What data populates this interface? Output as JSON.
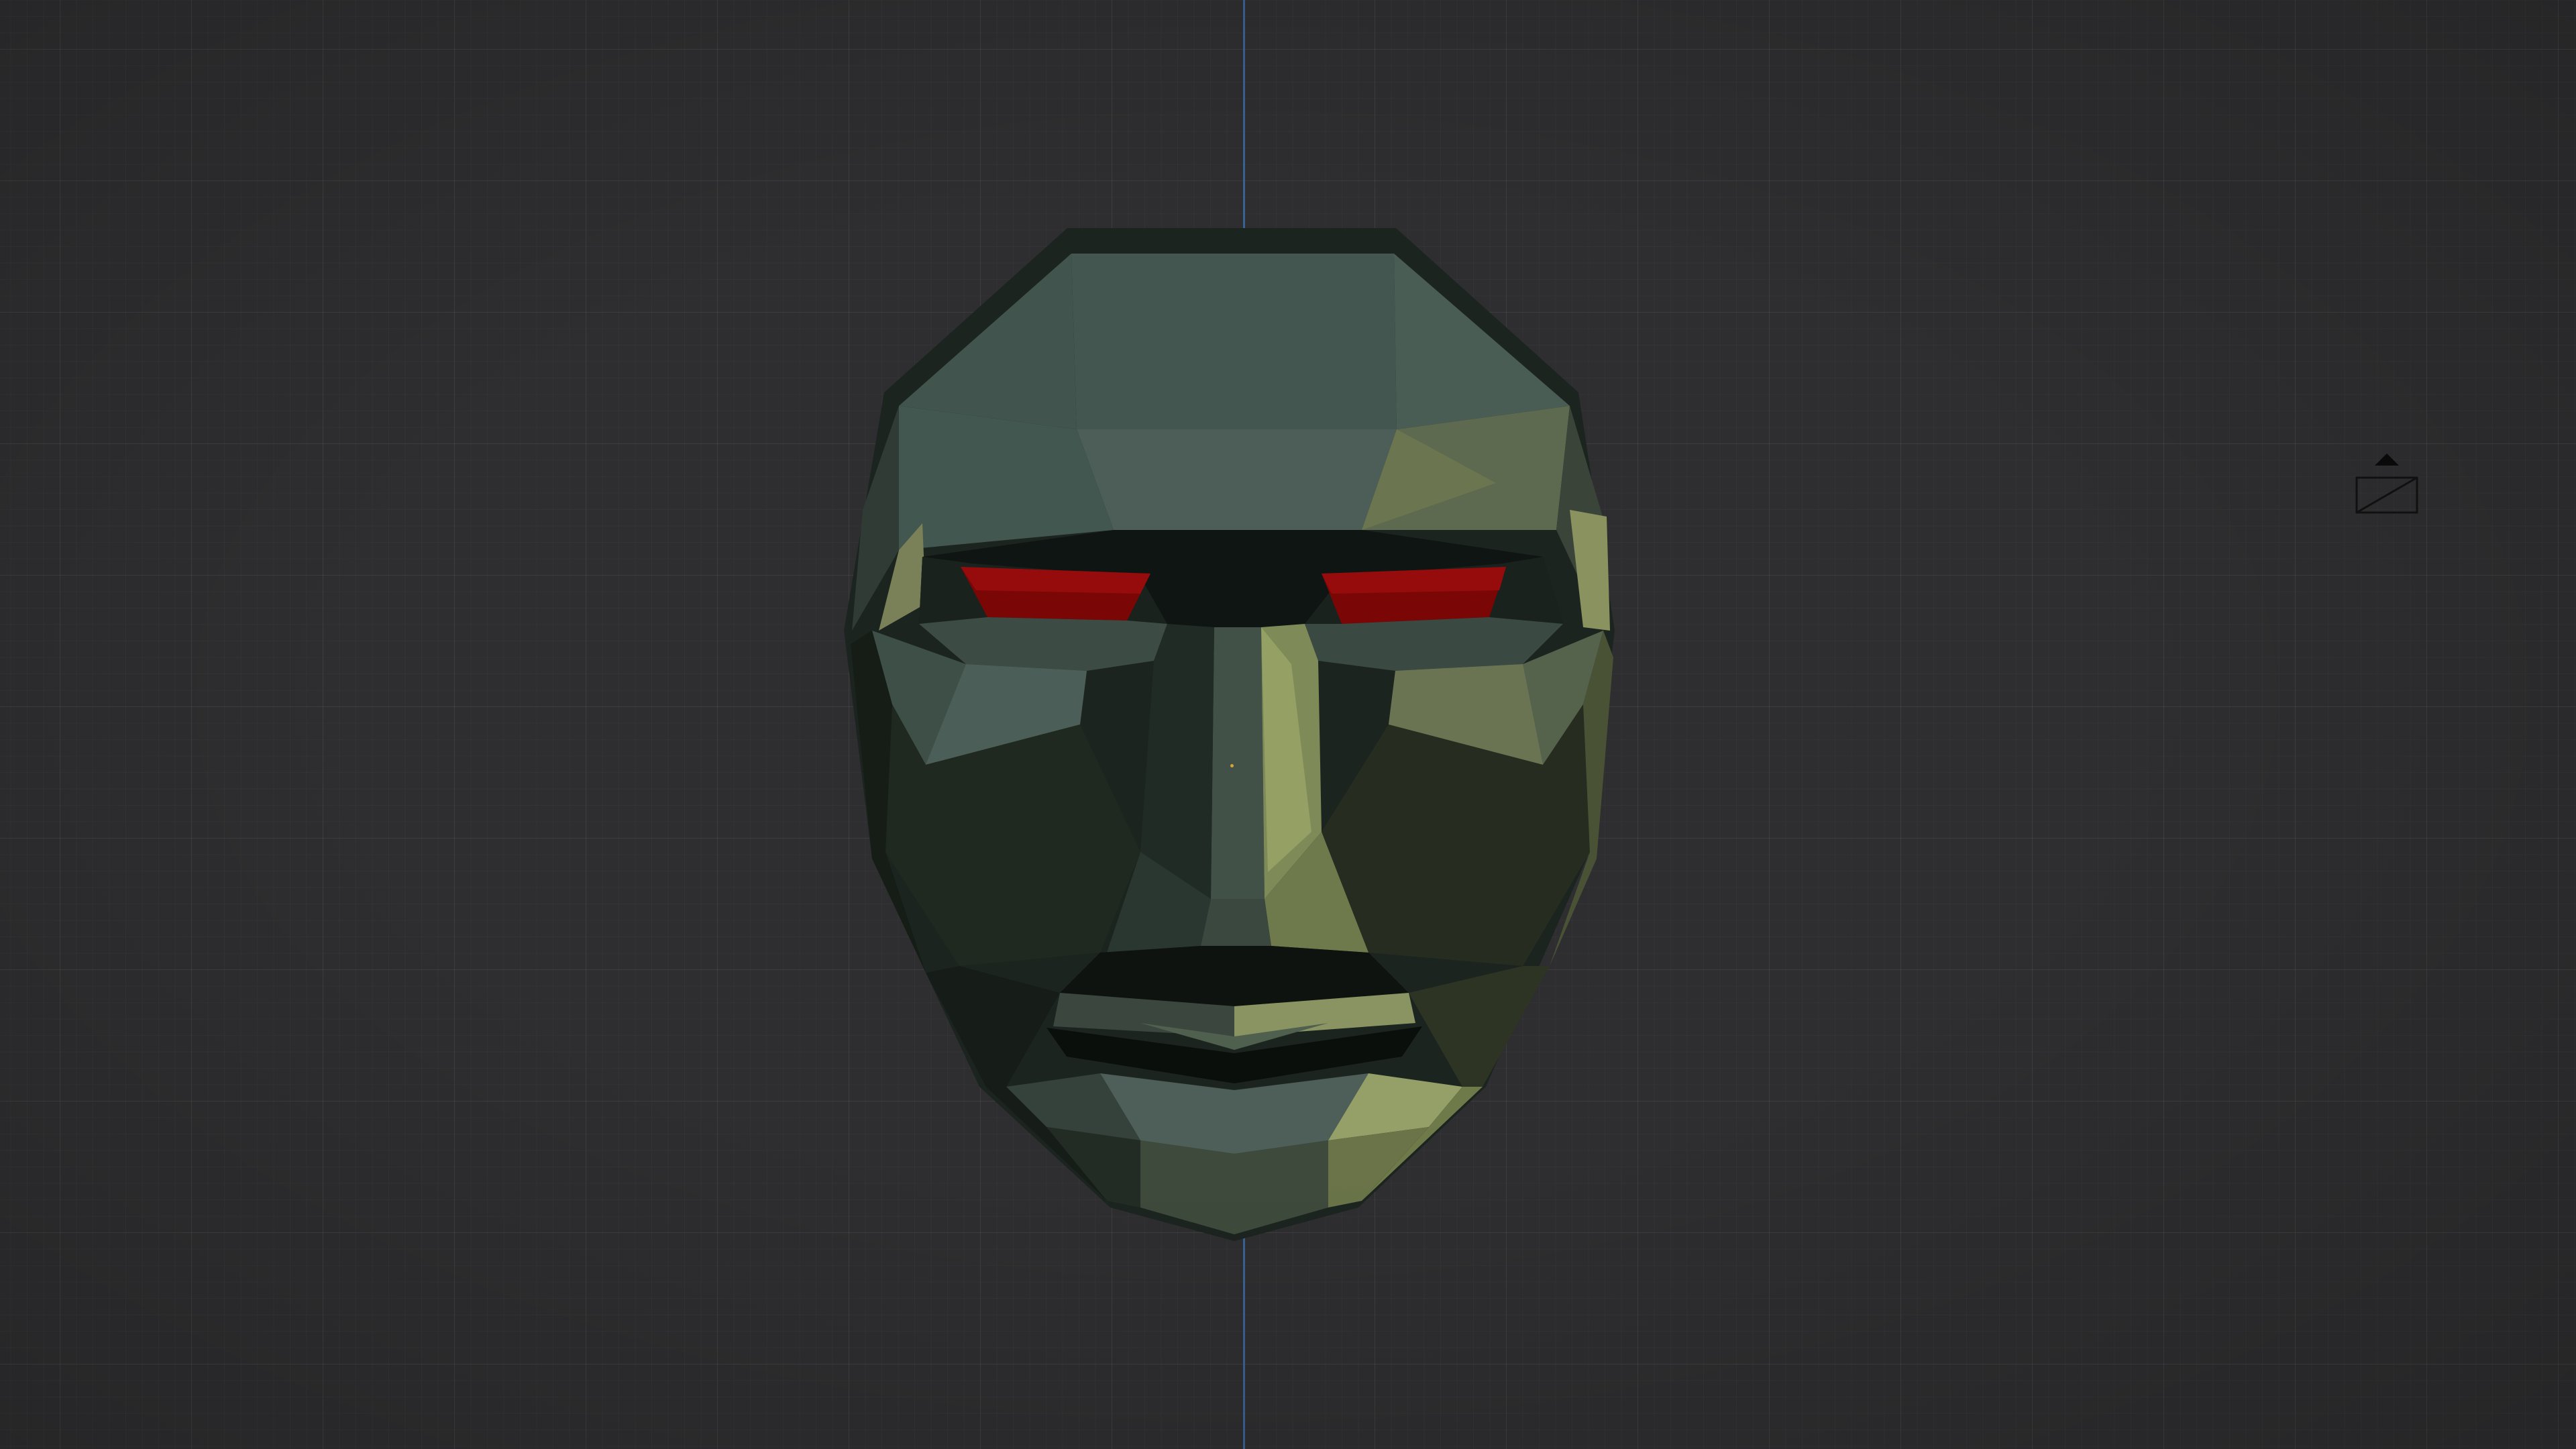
{
  "viewport": {
    "background_color": "#2e2e30",
    "grid_color": "#3a3a3c",
    "axis_z_color": "#3a6aa6"
  },
  "object": {
    "type": "low-poly face mesh",
    "primary_color": "#4e5e56",
    "accent_color": "#7e8a5a",
    "eye_color": "#8a0a0a"
  },
  "gizmos": {
    "camera_icon": "camera-icon",
    "origin_icon": "origin-dot-icon"
  }
}
